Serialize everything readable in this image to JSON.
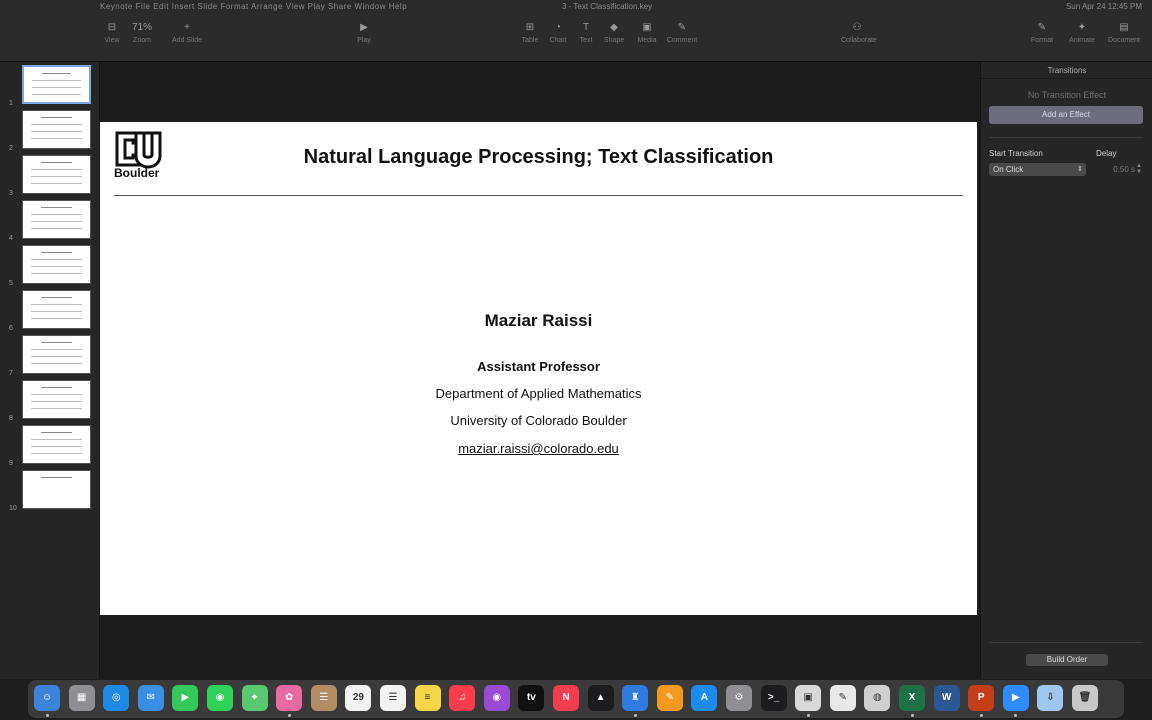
{
  "menubar": {
    "app_menus": "Keynote  File  Edit  Insert  Slide  Format  Arrange  View  Play  Share  Window  Help",
    "document": "3 - Text Classification.key",
    "clock": "Sun Apr 24  12:45 PM"
  },
  "toolbar": {
    "items": [
      {
        "glyph": "⊟",
        "label": "View"
      },
      {
        "glyph": "71%",
        "label": "Zoom"
      },
      {
        "glyph": "+",
        "label": "Add Slide"
      },
      {
        "glyph": "▶",
        "label": "Play"
      },
      {
        "glyph": "⊞",
        "label": "Table"
      },
      {
        "glyph": "◔",
        "label": "Chart"
      },
      {
        "glyph": "T",
        "label": "Text"
      },
      {
        "glyph": "◆",
        "label": "Shape"
      },
      {
        "glyph": "▣",
        "label": "Media"
      },
      {
        "glyph": "✎",
        "label": "Comment"
      },
      {
        "glyph": "⚇",
        "label": "Collaborate"
      },
      {
        "glyph": "✎",
        "label": "Format"
      },
      {
        "glyph": "✦",
        "label": "Animate"
      },
      {
        "glyph": "▤",
        "label": "Document"
      }
    ]
  },
  "navigator": {
    "slide_numbers": [
      "1",
      "2",
      "3",
      "4",
      "5",
      "6",
      "7",
      "8",
      "9",
      "10"
    ]
  },
  "slide": {
    "logo_text": "Boulder",
    "title": "Natural Language Processing; Text Classification",
    "author": "Maziar Raissi",
    "role": "Assistant Professor",
    "department": "Department of Applied Mathematics",
    "university": "University of Colorado Boulder",
    "email": "maziar.raissi@colorado.edu"
  },
  "inspector": {
    "title": "Transitions",
    "no_effect": "No Transition Effect",
    "add_effect": "Add an Effect",
    "start_label": "Start Transition",
    "start_value": "On Click",
    "delay_label": "Delay",
    "delay_value": "0.50 s",
    "build_order": "Build Order"
  },
  "dock": {
    "apps": [
      {
        "name": "finder-icon",
        "color": "#3d83d9",
        "glyph": "☺"
      },
      {
        "name": "launchpad-icon",
        "color": "#8e8e93",
        "glyph": "▦"
      },
      {
        "name": "safari-icon",
        "color": "#1e88e5",
        "glyph": "◎"
      },
      {
        "name": "mail-icon",
        "color": "#3a8ee6",
        "glyph": "✉"
      },
      {
        "name": "facetime-icon",
        "color": "#34c759",
        "glyph": "▶"
      },
      {
        "name": "messages-icon",
        "color": "#30d158",
        "glyph": "◉"
      },
      {
        "name": "maps-icon",
        "color": "#5ac86e",
        "glyph": "⌖"
      },
      {
        "name": "photos-icon",
        "color": "#e86aa0",
        "glyph": "✿"
      },
      {
        "name": "contacts-icon",
        "color": "#b08d62",
        "glyph": "☰"
      },
      {
        "name": "calendar-icon",
        "color": "#f2f2f2",
        "glyph": "29"
      },
      {
        "name": "reminders-icon",
        "color": "#f2f2f2",
        "glyph": "☰"
      },
      {
        "name": "notes-icon",
        "color": "#f5d547",
        "glyph": "≡"
      },
      {
        "name": "music-icon",
        "color": "#fa3c4c",
        "glyph": "♫"
      },
      {
        "name": "podcasts-icon",
        "color": "#9a4bd6",
        "glyph": "◉"
      },
      {
        "name": "apple-tv-icon",
        "color": "#111111",
        "glyph": "tv"
      },
      {
        "name": "news-icon",
        "color": "#f23d4f",
        "glyph": "N"
      },
      {
        "name": "stocks-icon",
        "color": "#1c1c1e",
        "glyph": "▲"
      },
      {
        "name": "keynote-icon",
        "color": "#2f7be0",
        "glyph": "♜"
      },
      {
        "name": "pages-icon",
        "color": "#f39a1e",
        "glyph": "✎"
      },
      {
        "name": "app-store-icon",
        "color": "#1d8cf2",
        "glyph": "A"
      },
      {
        "name": "system-preferences-icon",
        "color": "#8e8e93",
        "glyph": "⚙"
      },
      {
        "name": "terminal-icon",
        "color": "#1c1c1e",
        "glyph": ">_"
      },
      {
        "name": "screenshot-icon",
        "color": "#d9d9d9",
        "glyph": "▣"
      },
      {
        "name": "textedit-icon",
        "color": "#e8e8e8",
        "glyph": "✎"
      },
      {
        "name": "preview-icon",
        "color": "#cfcfcf",
        "glyph": "◍"
      },
      {
        "name": "excel-icon",
        "color": "#1e7145",
        "glyph": "X"
      },
      {
        "name": "word-icon",
        "color": "#2b5797",
        "glyph": "W"
      },
      {
        "name": "powerpoint-icon",
        "color": "#c43e1c",
        "glyph": "P"
      },
      {
        "name": "zoom-icon",
        "color": "#2d8cff",
        "glyph": "▶"
      },
      {
        "name": "downloads-icon",
        "color": "#9ec7f0",
        "glyph": "⇩"
      },
      {
        "name": "trash-icon",
        "color": "#c8c8c8",
        "glyph": "🗑"
      }
    ]
  }
}
